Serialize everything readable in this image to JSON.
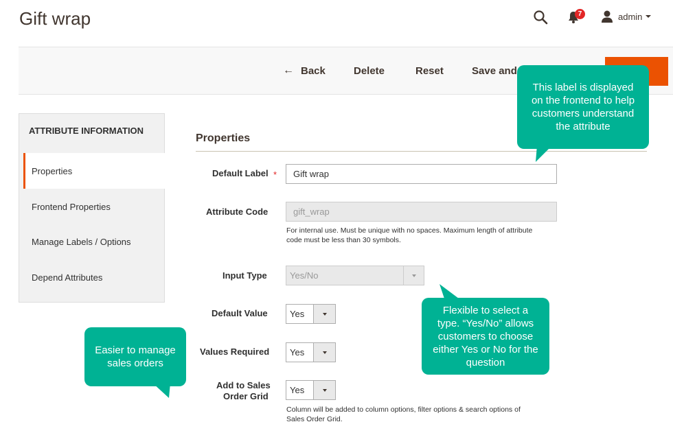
{
  "page": {
    "title": "Gift wrap"
  },
  "header": {
    "notification_count": "7",
    "user_name": "admin"
  },
  "toolbar": {
    "back_label": "Back",
    "delete_label": "Delete",
    "reset_label": "Reset",
    "save_continue_label": "Save and C"
  },
  "sidebar": {
    "title": "ATTRIBUTE INFORMATION",
    "items": [
      {
        "label": "Properties",
        "active": true
      },
      {
        "label": "Frontend Properties"
      },
      {
        "label": "Manage Labels / Options"
      },
      {
        "label": "Depend Attributes"
      }
    ]
  },
  "properties": {
    "section_title": "Properties",
    "default_label": {
      "label": "Default Label",
      "value": "Gift wrap"
    },
    "attribute_code": {
      "label": "Attribute Code",
      "placeholder": "gift_wrap",
      "note_line1": "For internal use. Must be unique with no spaces. Maximum length of attribute",
      "note_line2": "code must be less than 30 symbols."
    },
    "input_type": {
      "label": "Input Type",
      "value": "Yes/No"
    },
    "default_value": {
      "label": "Default Value",
      "value": "Yes"
    },
    "values_required": {
      "label": "Values Required",
      "value": "Yes"
    },
    "sales_grid": {
      "label_line1": "Add to Sales",
      "label_line2": "Order Grid",
      "value": "Yes",
      "note_line1": "Column will be added to column options, filter options & search options of",
      "note_line2": "Sales Order Grid."
    }
  },
  "callouts": {
    "label_help": [
      "This label is displayed",
      "on the frontend to help",
      "customers understand",
      "the attribute"
    ],
    "input_type_help": [
      "Flexible to select a",
      "type. “Yes/No” allows",
      "customers to choose",
      "either Yes or No for the",
      "question"
    ],
    "sales_help": [
      "Easier to manage",
      "sales orders"
    ]
  },
  "colors": {
    "accent": "#eb5202",
    "callout": "#00b294",
    "badge": "#e22626"
  }
}
